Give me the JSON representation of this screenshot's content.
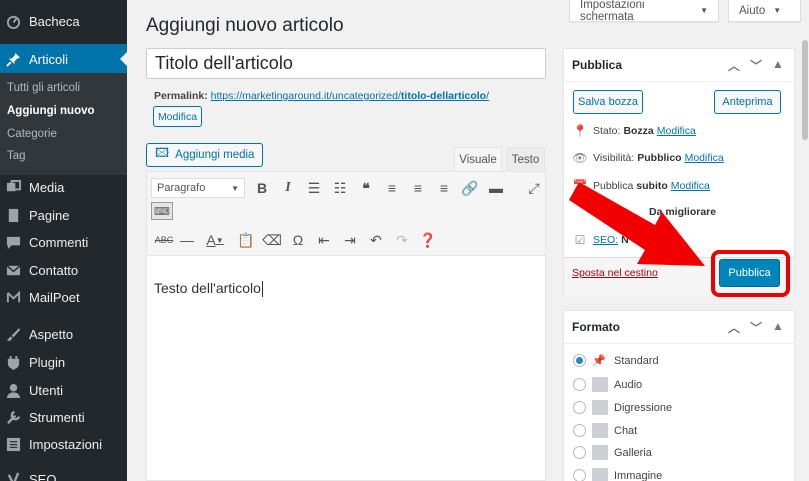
{
  "sidebar": {
    "items": [
      {
        "label": "Bacheca",
        "icon": "dashboard-icon"
      },
      {
        "label": "Articoli",
        "icon": "pin-icon",
        "current": true
      },
      {
        "label": "Media",
        "icon": "media-icon"
      },
      {
        "label": "Pagine",
        "icon": "pages-icon"
      },
      {
        "label": "Commenti",
        "icon": "comments-icon"
      },
      {
        "label": "Contatto",
        "icon": "mail-icon"
      },
      {
        "label": "MailPoet",
        "icon": "mailpoet-icon"
      },
      {
        "label": "Aspetto",
        "icon": "appearance-icon"
      },
      {
        "label": "Plugin",
        "icon": "plugin-icon"
      },
      {
        "label": "Utenti",
        "icon": "users-icon"
      },
      {
        "label": "Strumenti",
        "icon": "tools-icon"
      },
      {
        "label": "Impostazioni",
        "icon": "settings-icon"
      },
      {
        "label": "SEO",
        "icon": "seo-icon"
      }
    ],
    "submenu": [
      "Tutti gli articoli",
      "Aggiungi nuovo",
      "Categorie",
      "Tag"
    ]
  },
  "header": {
    "screen_options": "Impostazioni schermata",
    "help": "Aiuto",
    "page_title": "Aggiungi nuovo articolo"
  },
  "editor": {
    "title_value": "Titolo dell'articolo",
    "permalink_label": "Permalink:",
    "permalink_base": "https://marketingaround.it/uncategorized/",
    "permalink_slug": "titolo-dellarticolo",
    "permalink_end": "/",
    "edit_permalink": "Modifica",
    "add_media": "Aggiungi media",
    "tab_visual": "Visuale",
    "tab_text": "Testo",
    "format_select": "Paragrafo",
    "body_text": "Testo dell'articolo"
  },
  "publish_box": {
    "title": "Pubblica",
    "save_draft": "Salva bozza",
    "preview": "Anteprima",
    "status_label": "Stato:",
    "status_value": "Bozza",
    "visibility_label": "Visibilità:",
    "visibility_value": "Pubblico",
    "publish_label": "Pubblica",
    "publish_value": "subito",
    "readability_value": "Da migliorare",
    "seo_label": "SEO:",
    "seo_value": "N",
    "edit_link": "Modifica",
    "trash": "Sposta nel cestino",
    "publish_button": "Pubblica"
  },
  "format_box": {
    "title": "Formato",
    "options": [
      "Standard",
      "Audio",
      "Digressione",
      "Chat",
      "Galleria",
      "Immagine"
    ],
    "selected": "Standard"
  },
  "colors": {
    "accent": "#0073aa",
    "publish": "#0085ba",
    "highlight": "#e00000"
  }
}
